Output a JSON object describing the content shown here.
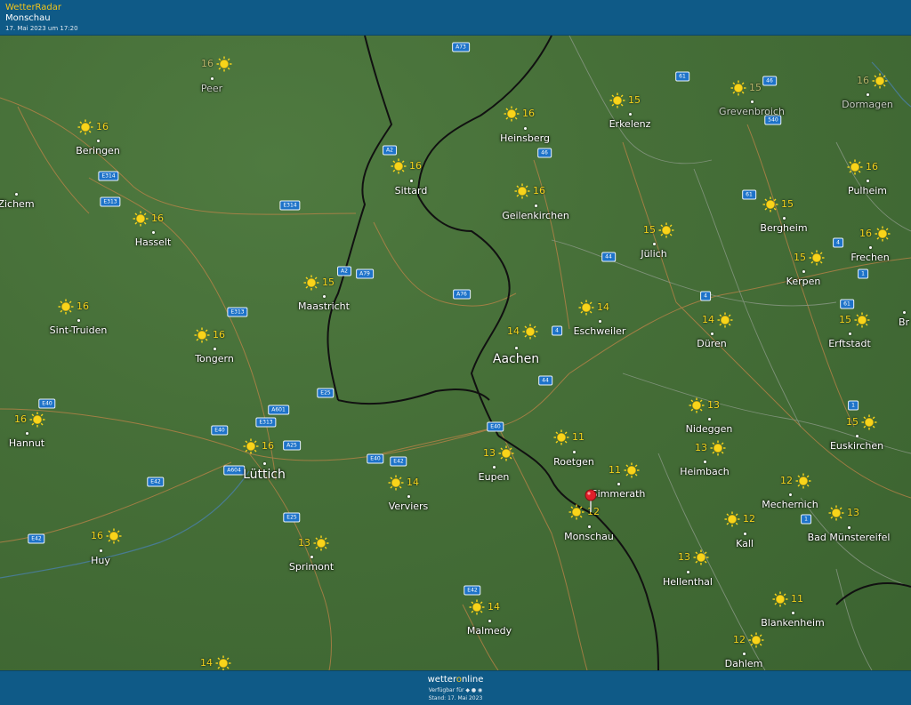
{
  "header": {
    "brand": "WetterRadar",
    "location": "Monschau",
    "date": "17. Mai 2023 um 17:20"
  },
  "cities": [
    {
      "name": "Peer",
      "temp": "16",
      "faded": true
    },
    {
      "name": "Beringen",
      "temp": "16"
    },
    {
      "name": "Zichem",
      "temp": ""
    },
    {
      "name": "Hasselt",
      "temp": "16"
    },
    {
      "name": "Sint-Truiden",
      "temp": "16"
    },
    {
      "name": "Tongern",
      "temp": "16"
    },
    {
      "name": "Hannut",
      "temp": "16"
    },
    {
      "name": "Lüttich",
      "temp": "16",
      "big": true
    },
    {
      "name": "Huy",
      "temp": "16"
    },
    {
      "name": "Sprimont",
      "temp": "13"
    },
    {
      "name": "Verviers",
      "temp": "14"
    },
    {
      "name": "Eupen",
      "temp": "13"
    },
    {
      "name": "Malmedy",
      "temp": "14"
    },
    {
      "name": "Maastricht",
      "temp": "15"
    },
    {
      "name": "Sittard",
      "temp": "16"
    },
    {
      "name": "Heinsberg",
      "temp": "16"
    },
    {
      "name": "Geilenkirchen",
      "temp": "16"
    },
    {
      "name": "Erkelenz",
      "temp": "15"
    },
    {
      "name": "Grevenbroich",
      "temp": "15",
      "faded": true
    },
    {
      "name": "Dormagen",
      "temp": "16",
      "faded": true
    },
    {
      "name": "Pulheim",
      "temp": "16"
    },
    {
      "name": "Bergheim",
      "temp": "15"
    },
    {
      "name": "Jülich",
      "temp": "15"
    },
    {
      "name": "Frechen",
      "temp": "16"
    },
    {
      "name": "Kerpen",
      "temp": "15"
    },
    {
      "name": "Aachen",
      "temp": "14",
      "big": true
    },
    {
      "name": "Eschweiler",
      "temp": "14"
    },
    {
      "name": "Düren",
      "temp": "14"
    },
    {
      "name": "Erftstadt",
      "temp": "15"
    },
    {
      "name": "Br",
      "temp": ""
    },
    {
      "name": "Nideggen",
      "temp": "13"
    },
    {
      "name": "Roetgen",
      "temp": "11"
    },
    {
      "name": "Heimbach",
      "temp": "13"
    },
    {
      "name": "Euskirchen",
      "temp": "15"
    },
    {
      "name": "Simmerath",
      "temp": "11"
    },
    {
      "name": "Mechernich",
      "temp": "12"
    },
    {
      "name": "Monschau",
      "temp": "12"
    },
    {
      "name": "Kall",
      "temp": "12"
    },
    {
      "name": "Bad Münstereifel",
      "temp": "13"
    },
    {
      "name": "Hellenthal",
      "temp": "13"
    },
    {
      "name": "Blankenheim",
      "temp": "11"
    },
    {
      "name": "Dahlem",
      "temp": "12"
    },
    {
      "name": "",
      "temp": "14"
    }
  ],
  "road_shields": [
    "A73",
    "61",
    "46",
    "540",
    "46",
    "A2",
    "E314",
    "E313",
    "E314",
    "61",
    "4",
    "A2",
    "A79",
    "A76",
    "44",
    "4",
    "E313",
    "1",
    "61",
    "E25",
    "4",
    "44",
    "1",
    "E40",
    "A601",
    "E313",
    "E40",
    "A25",
    "A604",
    "E40",
    "E42",
    "E42",
    "E25",
    "E42",
    "1",
    "E40",
    "E42"
  ],
  "icons": {
    "weather": "sun-icon",
    "marker": "location-pin-icon"
  },
  "colors": {
    "header_bg": "#0f5a87",
    "brand": "#f3c419",
    "temp": "#f4d21c",
    "shield": "#1e73c9",
    "pin": "#e0202a"
  },
  "footer": {
    "logo_prefix": "wetter",
    "logo_o": "o",
    "logo_suffix": "nline",
    "availability": "Verfügbar für",
    "stand": "Stand: 17. Mai 2023"
  }
}
